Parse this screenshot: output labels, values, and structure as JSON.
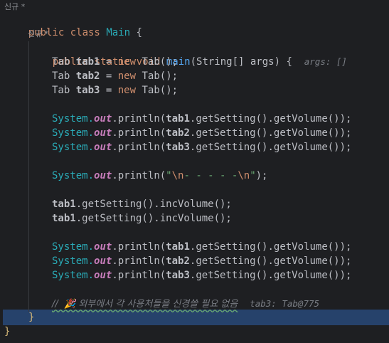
{
  "hints": {
    "top": "신규 *",
    "method": "신규 *"
  },
  "code": {
    "class_decl": {
      "kw": "public class",
      "name": "Main",
      "brace": "{"
    },
    "method_decl": {
      "kw": "public static void",
      "name": "main",
      "params": "(String[] args) {",
      "param_hint": "args: []"
    },
    "decls": [
      {
        "type": "Tab",
        "var": "tab1",
        "eq": " = ",
        "new": "new",
        "ctor": "Tab",
        "rest": "();"
      },
      {
        "type": "Tab",
        "var": "tab2",
        "eq": " = ",
        "new": "new",
        "ctor": "Tab",
        "rest": "();"
      },
      {
        "type": "Tab",
        "var": "tab3",
        "eq": " = ",
        "new": "new",
        "ctor": "Tab",
        "rest": "();"
      }
    ],
    "prints1": [
      "tab1",
      "tab2",
      "tab3"
    ],
    "sep_line": {
      "prefix": "System.",
      "out": "out",
      "call": ".println(",
      "str_a": "\"",
      "esc1": "\\n",
      "mid": "- - - - -",
      "esc2": "\\n",
      "str_b": "\"",
      "end": ");"
    },
    "inc": [
      {
        "var": "tab1",
        "rest": ".getSetting().incVolume();"
      },
      {
        "var": "tab1",
        "rest": ".getSetting().incVolume();"
      }
    ],
    "prints2": [
      "tab1",
      "tab2",
      "tab3"
    ],
    "comment": "//  🎉 외부에서 각 사용처들을 신경쓸 필요 없음",
    "comment_hint": "tab3: Tab@775",
    "close_method": "}",
    "close_class": "}"
  },
  "colors": {
    "background": "#1e1f22",
    "current_line": "#26426b",
    "keyword": "#cf8e6d",
    "method": "#56a8f5",
    "field": "#c77dbb",
    "string": "#6aab73",
    "comment": "#7a7e85"
  }
}
